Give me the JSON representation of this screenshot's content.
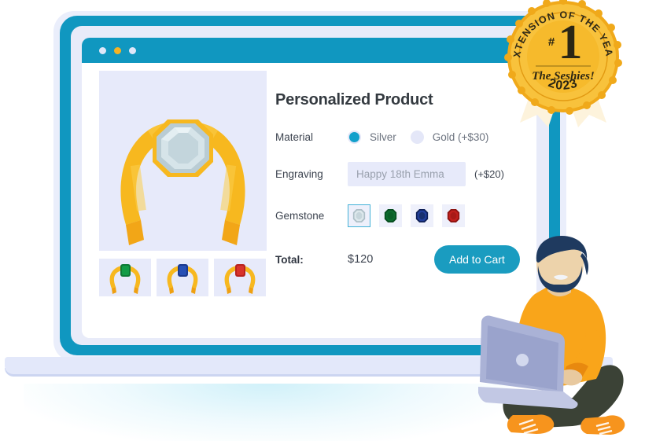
{
  "window": {
    "dots": [
      {
        "name": "minimize-dot",
        "color": "#dfe7f9"
      },
      {
        "name": "maximize-dot",
        "color": "#f5b324"
      },
      {
        "name": "close-dot",
        "color": "#dfe7f9"
      }
    ]
  },
  "product": {
    "title": "Personalized Product",
    "hero_alt": "gold-cuff-bracelet-clear-gem",
    "thumbnails": [
      {
        "label": "emerald-variant",
        "gem_color": "#0d7a36",
        "gem_dark": "#0a5c28"
      },
      {
        "label": "sapphire-variant",
        "gem_color": "#1b3a8f",
        "gem_dark": "#142a6b"
      },
      {
        "label": "ruby-variant",
        "gem_color": "#b8231f",
        "gem_dark": "#8f1a16"
      }
    ]
  },
  "options": {
    "material": {
      "label": "Material",
      "choices": [
        {
          "value": "silver",
          "label": "Silver",
          "selected": true
        },
        {
          "value": "gold",
          "label": "Gold (+$30)",
          "selected": false
        }
      ]
    },
    "engraving": {
      "label": "Engraving",
      "value": "",
      "placeholder": "Happy 18th Emma",
      "surcharge": "(+$20)"
    },
    "gemstone": {
      "label": "Gemstone",
      "choices": [
        {
          "name": "diamond",
          "color": "#c9d6dc",
          "dark": "#9fb3bd",
          "selected": true
        },
        {
          "name": "emerald",
          "color": "#0d6b2e",
          "dark": "#074d1f",
          "selected": false
        },
        {
          "name": "sapphire",
          "color": "#1b3580",
          "dark": "#0f2057",
          "selected": false
        },
        {
          "name": "ruby",
          "color": "#c0201d",
          "dark": "#8c1412",
          "selected": false
        }
      ]
    }
  },
  "checkout": {
    "total_label": "Total:",
    "total_value": "$120",
    "cart_button": "Add to Cart"
  },
  "award_badge": {
    "ring_text": "EXTENSION OF THE YEAR",
    "rank": "#1",
    "organization": "The Seshies!",
    "year": "2023"
  },
  "colors": {
    "accent_teal": "#1097c0",
    "button_teal": "#1a9cc0",
    "lavender": "#e7eafa",
    "badge_gold": "#f5b324",
    "badge_deep": "#e8a317",
    "sweater_orange": "#f9a51a",
    "hair_navy": "#1f3a5f"
  }
}
